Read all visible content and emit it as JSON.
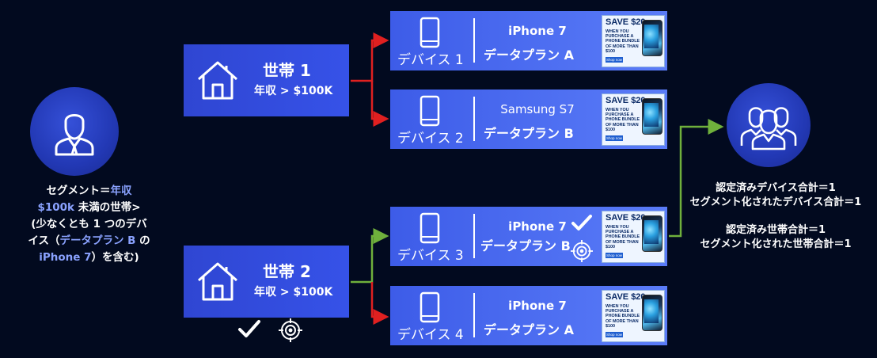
{
  "segment": {
    "line1_prefix": "セグメント＝",
    "line1_highlight": "年収",
    "line2_highlight": "$100k",
    "line2_suffix": " 未満の世帯>",
    "line3": "(少なくとも 1 つのデバ",
    "line4_prefix": "イス（",
    "line4_highlight": "データプラン B",
    "line4_suffix": " の",
    "line5_highlight": "iPhone 7",
    "line5_suffix": "）を含む)"
  },
  "households": [
    {
      "title": "世帯 1",
      "income": "年収 > $100K"
    },
    {
      "title": "世帯 2",
      "income": "年収 > $100K"
    }
  ],
  "devices": [
    {
      "label": "デバイス 1",
      "model": "iPhone 7",
      "plan": "データプラン A"
    },
    {
      "label": "デバイス 2",
      "model": "Samsung S7",
      "plan": "データプラン B"
    },
    {
      "label": "デバイス 3",
      "model": "iPhone 7",
      "plan": "データプラン B"
    },
    {
      "label": "デバイス 4",
      "model": "iPhone 7",
      "plan": "データプラン A"
    }
  ],
  "ad": {
    "headline": "SAVE $20",
    "body": "WHEN YOU PURCHASE A PHONE BUNDLE OF MORE THAN $100",
    "cta": "Shop now"
  },
  "stats": {
    "device_qualified": "認定済みデバイス合計＝1",
    "device_segmented": "セグメント化されたデバイス合計＝1",
    "household_qualified": "認定済み世帯合計＝1",
    "household_segmented": "セグメント化された世帯合計＝1"
  },
  "colors": {
    "background": "#020a1f",
    "box": "#3652e8",
    "red_connector": "#e02020",
    "green_connector": "#6fb03c",
    "highlight_text": "#8aa2ff"
  },
  "icons": [
    "user-icon",
    "house-icon",
    "phone-icon",
    "checkmark-icon",
    "target-icon",
    "group-icon"
  ]
}
